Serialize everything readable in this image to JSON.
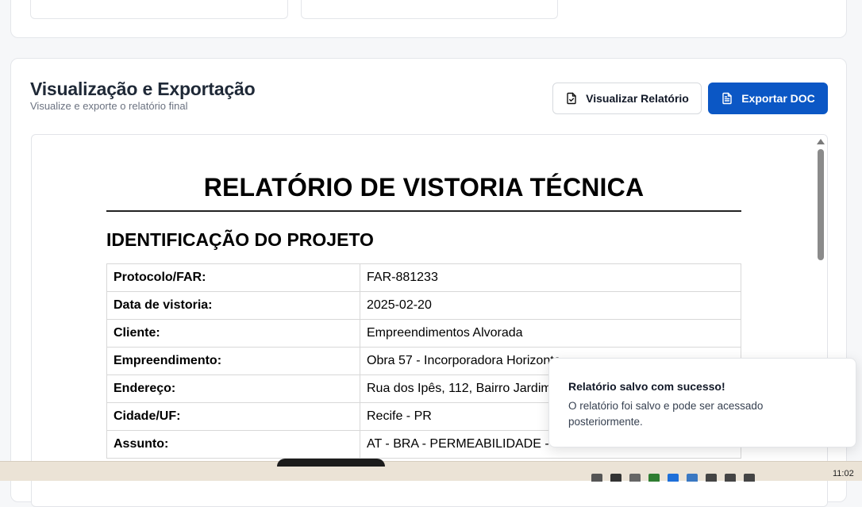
{
  "section": {
    "title": "Visualização e Exportação",
    "subtitle": "Visualize e exporte o relatório final"
  },
  "buttons": {
    "view_label": "Visualizar Relatório",
    "view_icon": "file-check-icon",
    "export_label": "Exportar DOC",
    "export_icon": "file-text-icon"
  },
  "report": {
    "title": "RELATÓRIO DE VISTORIA TÉCNICA",
    "section_heading": "IDENTIFICAÇÃO DO PROJETO",
    "rows": [
      {
        "label": "Protocolo/FAR:",
        "value": "FAR-881233"
      },
      {
        "label": "Data de vistoria:",
        "value": "2025-02-20"
      },
      {
        "label": "Cliente:",
        "value": "Empreendimentos Alvorada"
      },
      {
        "label": "Empreendimento:",
        "value": "Obra 57 - Incorporadora Horizonte"
      },
      {
        "label": "Endereço:",
        "value": "Rua dos Ipês, 112, Bairro Jardim"
      },
      {
        "label": "Cidade/UF:",
        "value": "Recife - PR"
      },
      {
        "label": "Assunto:",
        "value": "AT - BRA - PERMEABILIDADE - Telhado com Vazamento Geral"
      }
    ]
  },
  "toast": {
    "title": "Relatório salvo com sucesso!",
    "message": "O relatório foi salvo e pode ser acessado posteriormente."
  },
  "taskbar": {
    "clock": "11:02"
  },
  "colors": {
    "primary": "#0b57c5",
    "taskbar": "#ebe3d6"
  }
}
